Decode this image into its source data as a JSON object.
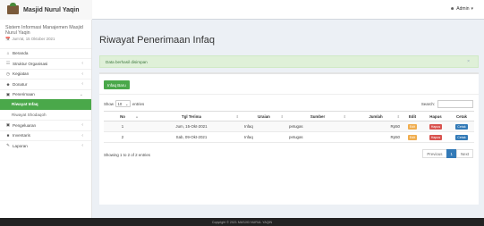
{
  "brand": {
    "title": "Masjid Nurul Yaqin"
  },
  "topbar": {
    "user_label": "Admin"
  },
  "sidebar": {
    "system_title": "Sistem Informasi Manajemen Masjid Nurul Yaqin",
    "date": "Jum'at, 15 Oktober 2021",
    "items": [
      {
        "label": "Beranda",
        "icon": "home-icon",
        "has_children": false
      },
      {
        "label": "Struktur Organisasi",
        "icon": "sitemap-icon",
        "has_children": true
      },
      {
        "label": "Kegiatan",
        "icon": "calendar-icon",
        "has_children": true
      },
      {
        "label": "Donatur",
        "icon": "users-icon",
        "has_children": true
      },
      {
        "label": "Penerimaan",
        "icon": "money-icon",
        "has_children": true,
        "expanded": true
      }
    ],
    "subitems": [
      {
        "label": "Riwayat Infaq",
        "active": true
      },
      {
        "label": "Riwayat Shodaqoh",
        "active": false
      }
    ],
    "items_after": [
      {
        "label": "Pengeluaran",
        "icon": "money-out-icon",
        "has_children": true
      },
      {
        "label": "Inventaris",
        "icon": "box-icon",
        "has_children": true
      },
      {
        "label": "Laporan",
        "icon": "report-icon",
        "has_children": true
      }
    ]
  },
  "main": {
    "page_title": "Riwayat Penerimaan Infaq",
    "alert": "Data berhasil disimpan",
    "add_button": "Infaq Baru",
    "show_label": "Show",
    "entries_value": "10",
    "entries_label": "entries",
    "search_label": "Search:",
    "table": {
      "columns": [
        "No",
        "Tgl Terima",
        "Uraian",
        "Sumber",
        "Jumlah",
        "Edit",
        "Hapus",
        "Cetak"
      ],
      "rows": [
        {
          "no": "1",
          "tgl": "Jum, 15-Okt-2021",
          "uraian": "Infaq",
          "sumber": "petugas",
          "jumlah": "Rp50",
          "edit": "Edit",
          "hapus": "Hapus",
          "cetak": "Cetak"
        },
        {
          "no": "2",
          "tgl": "Sab, 09-Okt-2021",
          "uraian": "Infaq",
          "sumber": "petugas",
          "jumlah": "Rp50",
          "edit": "Edit",
          "hapus": "Hapus",
          "cetak": "Cetak"
        }
      ]
    },
    "info": "Showing 1 to 2 of 2 entries",
    "pager": {
      "previous": "Previous",
      "current": "1",
      "next": "Next"
    }
  },
  "footer": {
    "text": "Copyright © 2021 MASJID NURUL YAQIN"
  }
}
